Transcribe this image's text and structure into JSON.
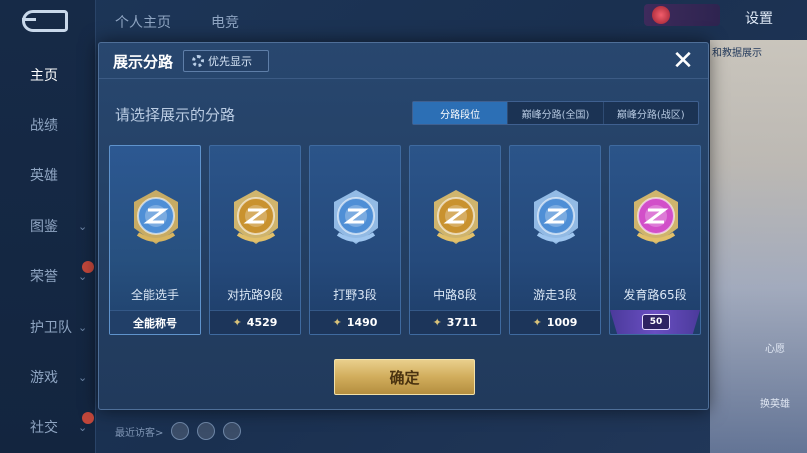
{
  "nav": {
    "items": [
      {
        "label": "主页",
        "active": true,
        "chevron": false,
        "dot": false
      },
      {
        "label": "战绩",
        "active": false,
        "chevron": false,
        "dot": false
      },
      {
        "label": "英雄",
        "active": false,
        "chevron": false,
        "dot": false
      },
      {
        "label": "图鉴",
        "active": false,
        "chevron": true,
        "dot": false
      },
      {
        "label": "荣誉",
        "active": false,
        "chevron": true,
        "dot": true
      },
      {
        "label": "护卫队",
        "active": false,
        "chevron": true,
        "dot": false
      },
      {
        "label": "游戏",
        "active": false,
        "chevron": true,
        "dot": false
      },
      {
        "label": "社交",
        "active": false,
        "chevron": true,
        "dot": true
      }
    ]
  },
  "top": {
    "tabs": [
      "个人主页",
      "电竞"
    ],
    "settings_label": "设置",
    "badge_text": "",
    "right_label": "和教据展示",
    "right_icons": [
      "心愿",
      "换英雄"
    ]
  },
  "bottom": {
    "recent_label": "最近访客>"
  },
  "modal": {
    "title": "展示分路",
    "priority_label": "优先显示",
    "subtitle": "请选择展示的分路",
    "segments": [
      {
        "label": "分路段位",
        "active": true
      },
      {
        "label": "巅峰分路(全国)",
        "active": false
      },
      {
        "label": "巅峰分路(战区)",
        "active": false
      }
    ],
    "cards": [
      {
        "name": "全能选手",
        "footer": "全能称号",
        "kind": "title",
        "emblem_color": "#4f8fd6",
        "frame_color": "#d8b560"
      },
      {
        "name": "对抗路9段",
        "footer": "4529",
        "kind": "score",
        "emblem_color": "#c9922f",
        "frame_color": "#e2c06a"
      },
      {
        "name": "打野3段",
        "footer": "1490",
        "kind": "score",
        "emblem_color": "#4f8fd6",
        "frame_color": "#9fc6ef"
      },
      {
        "name": "中路8段",
        "footer": "3711",
        "kind": "score",
        "emblem_color": "#c9922f",
        "frame_color": "#e2c06a"
      },
      {
        "name": "游走3段",
        "footer": "1009",
        "kind": "score",
        "emblem_color": "#4f8fd6",
        "frame_color": "#9fc6ef"
      },
      {
        "name": "发育路65段",
        "footer": "50",
        "kind": "peak",
        "emblem_color": "#d24fc9",
        "frame_color": "#e2c06a"
      }
    ],
    "confirm_label": "确定",
    "colors": {
      "accent": "#2c6fb5",
      "confirm": "#d1ad5c",
      "peak": "#6a4fc2"
    }
  }
}
